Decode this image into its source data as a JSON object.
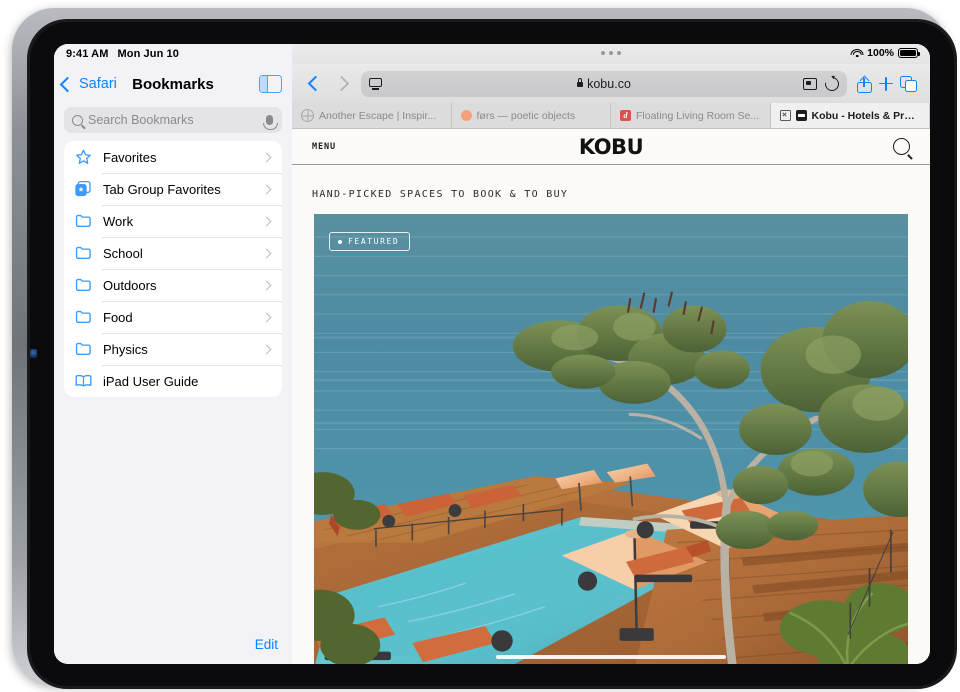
{
  "device": {
    "status_bar": {
      "time": "9:41 AM",
      "date": "Mon Jun 10",
      "battery_percent": "100%",
      "wifi_icon": "wifi-icon",
      "battery_icon": "battery-full-icon"
    },
    "home_indicator": "home-indicator",
    "multitask_handle": "three-dots-icon"
  },
  "sidebar": {
    "back_label": "Safari",
    "title": "Bookmarks",
    "toggle_icon": "sidebar-toggle-icon",
    "search": {
      "placeholder": "Search Bookmarks",
      "value": "",
      "search_icon": "search-icon",
      "mic_icon": "microphone-icon"
    },
    "items": [
      {
        "label": "Favorites",
        "icon": "star-icon",
        "chevron": true
      },
      {
        "label": "Tab Group Favorites",
        "icon": "tab-group-star-icon",
        "chevron": true
      },
      {
        "label": "Work",
        "icon": "folder-icon",
        "chevron": true
      },
      {
        "label": "School",
        "icon": "folder-icon",
        "chevron": true
      },
      {
        "label": "Outdoors",
        "icon": "folder-icon",
        "chevron": true
      },
      {
        "label": "Food",
        "icon": "folder-icon",
        "chevron": true
      },
      {
        "label": "Physics",
        "icon": "folder-icon",
        "chevron": true
      },
      {
        "label": "iPad User Guide",
        "icon": "book-icon",
        "chevron": false
      }
    ],
    "edit_label": "Edit"
  },
  "browser": {
    "back_icon": "chevron-left-icon",
    "forward_icon": "chevron-right-icon",
    "address_bar": {
      "reader_icon": "reader-view-icon",
      "lock_icon": "lock-icon",
      "url": "kobu.co",
      "extension_icon": "extension-puzzle-icon",
      "reload_icon": "reload-icon"
    },
    "share_icon": "share-icon",
    "new_tab_icon": "plus-icon",
    "tab_overview_icon": "tab-overview-icon",
    "tabs": [
      {
        "title": "Another Escape | Inspir...",
        "favicon": "globe-icon",
        "active": false,
        "closable": false
      },
      {
        "title": "førs — poetic objects",
        "favicon": "orange-dot-icon",
        "active": false,
        "closable": false
      },
      {
        "title": "Floating Living Room Se...",
        "favicon": "dwell-d-icon",
        "active": false,
        "closable": false
      },
      {
        "title": "Kobu - Hotels & Propert...",
        "favicon": "kobu-icon",
        "active": true,
        "closable": true
      }
    ]
  },
  "webpage": {
    "menu_label": "MENU",
    "brand": "KOBU",
    "search_icon": "search-icon",
    "kicker": "HAND-PICKED SPACES TO BOOK & TO BUY",
    "hero": {
      "badge_label": "FEATURED",
      "badge_dot": "bullet-dot-icon",
      "alt": "Aerial view of a cliffside infinity pool with orange loungers, peach umbrellas, wooden deck and trees overlooking the ocean"
    }
  },
  "colors": {
    "accent_blue": "#0a84ff",
    "page_bg": "#fbfaf6",
    "sidebar_bg": "#f2f2f7",
    "ocean": "#4e8ba3",
    "umbrella": "#f0b487",
    "lounger": "#c95f3a",
    "deck": "#b5703c"
  }
}
